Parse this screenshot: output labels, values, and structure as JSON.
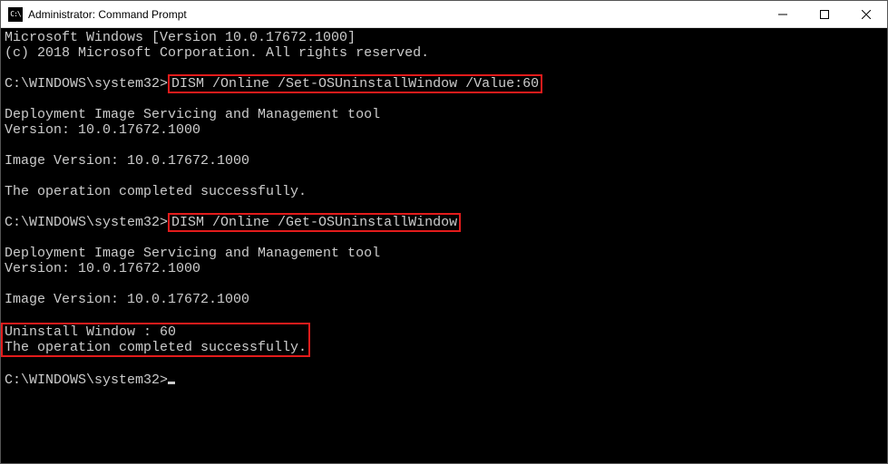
{
  "window": {
    "title": "Administrator: Command Prompt"
  },
  "term": {
    "line1": "Microsoft Windows [Version 10.0.17672.1000]",
    "line2": "(c) 2018 Microsoft Corporation. All rights reserved.",
    "prompt": "C:\\WINDOWS\\system32>",
    "cmd1": "DISM /Online /Set-OSUninstallWindow /Value:60",
    "dism_name": "Deployment Image Servicing and Management tool",
    "dism_ver": "Version: 10.0.17672.1000",
    "img_ver": "Image Version: 10.0.17672.1000",
    "success": "The operation completed successfully.",
    "cmd2": "DISM /Online /Get-OSUninstallWindow",
    "uninstall": "Uninstall Window : 60"
  }
}
